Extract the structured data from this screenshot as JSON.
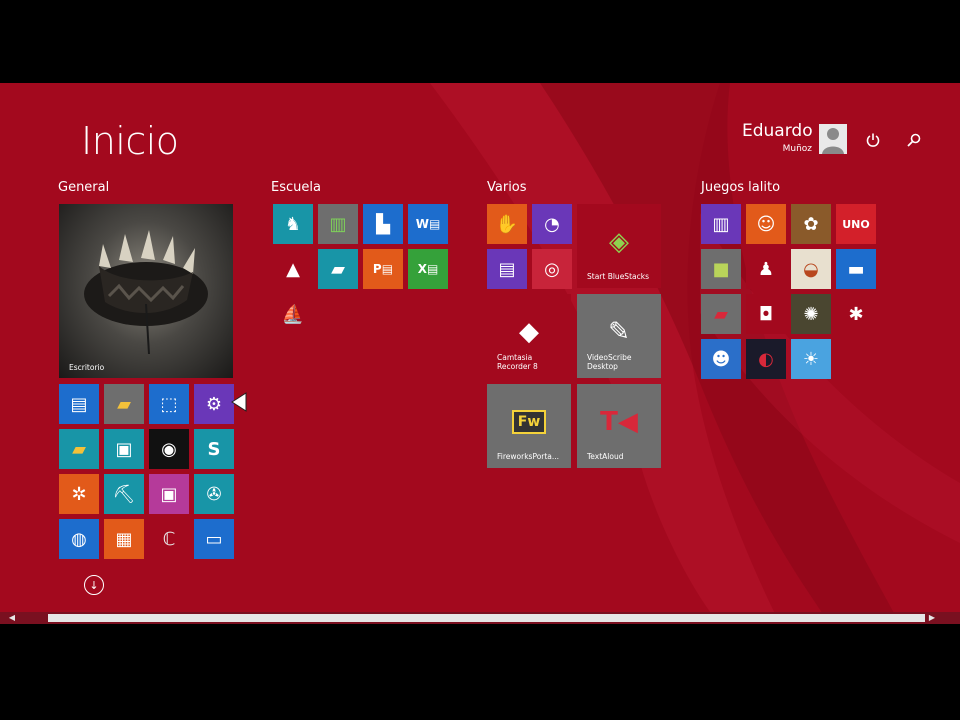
{
  "start": {
    "title": "Inicio"
  },
  "user": {
    "first_name": "Eduardo",
    "last_name": "Muñoz"
  },
  "colors": {
    "background": "#a3091e",
    "tile_blue": "#1d6dcd",
    "tile_orange": "#e25a1a",
    "tile_green": "#35a13a",
    "tile_teal": "#1895a7",
    "tile_purple": "#6a37b8",
    "tile_gray": "#6e6e6e"
  },
  "groups": {
    "general": "General",
    "escuela": "Escuela",
    "varios": "Varios",
    "juegos": "Juegos lalito"
  },
  "tiles": {
    "escritorio": "Escritorio",
    "start_bluestacks": "Start BlueStacks",
    "camtasia": "Camtasia Recorder 8",
    "videoscribe": "VideoScribe Desktop",
    "fireworks": "FireworksPorta...",
    "textaloud": "TextAloud"
  },
  "icons": {
    "power": "power-icon",
    "search": "search-icon",
    "all_apps": "arrow-down-circle-icon"
  }
}
